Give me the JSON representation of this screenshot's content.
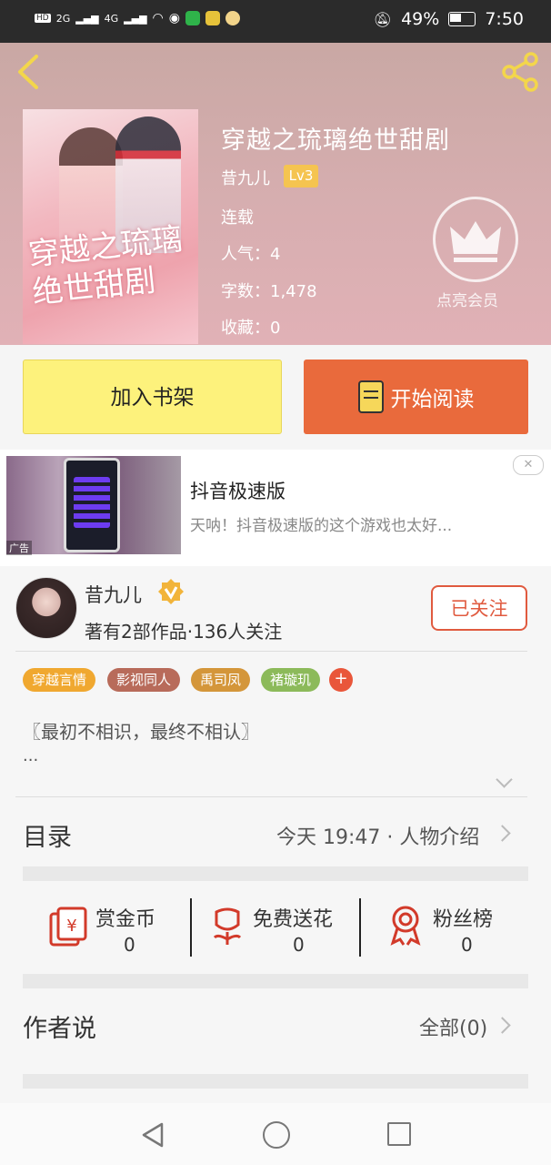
{
  "status": {
    "left_icons": [
      "HD",
      "2G",
      "4G",
      "wifi-icon",
      "wechat-icon",
      "app-icon-green",
      "app-icon-yellow",
      "app-icon-face"
    ],
    "hd": "HD",
    "net1": "2G",
    "net2": "4G",
    "battery": "49%",
    "time": "7:50"
  },
  "book": {
    "title": "穿越之琉璃绝世甜剧",
    "cover_text": "穿越之琉璃绝世甜剧",
    "author": "昔九儿",
    "level": "Lv3",
    "status": "连载",
    "popularity": "人气：4",
    "words": "字数：1,478",
    "favorites": "收藏：0"
  },
  "vip": {
    "label": "点亮会员"
  },
  "actions": {
    "shelf": "加入书架",
    "read": "开始阅读"
  },
  "ad": {
    "title": "抖音极速版",
    "desc": "天呐！抖音极速版的这个游戏也太好...",
    "tag": "广告",
    "close": "✕"
  },
  "author_card": {
    "name": "昔九儿",
    "stats": "著有2部作品·136人关注",
    "follow": "已关注"
  },
  "tags": [
    {
      "label": "穿越言情",
      "color": "#f0a830"
    },
    {
      "label": "影视同人",
      "color": "#b86b5a"
    },
    {
      "label": "禹司凤",
      "color": "#d4963a"
    },
    {
      "label": "褚璇玑",
      "color": "#8cba5a"
    }
  ],
  "tag_add": "+",
  "intro": {
    "quote": "〖最初不相识，最终不相认〗",
    "more": "..."
  },
  "catalog": {
    "title": "目录",
    "latest": "今天 19:47 · 人物介绍"
  },
  "stats": [
    {
      "label": "赏金币",
      "value": "0"
    },
    {
      "label": "免费送花",
      "value": "0"
    },
    {
      "label": "粉丝榜",
      "value": "0"
    }
  ],
  "author_says": {
    "title": "作者说",
    "all": "全部(0)"
  }
}
